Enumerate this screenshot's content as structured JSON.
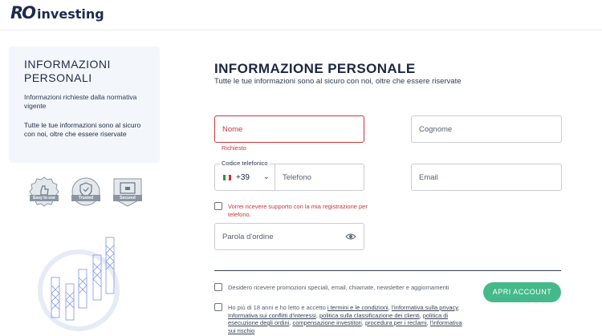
{
  "header": {
    "logo_mark": "RO",
    "logo_text": "investing"
  },
  "info_panel": {
    "title": "INFORMAZIONI PERSONALI",
    "subtitle": "Informazioni richieste dalla normativa vigente",
    "note": "Tutte le tue informazioni sono al sicuro con noi, oltre che essere riservate"
  },
  "badges": [
    {
      "label": "Easy to use",
      "icon": "thumbs-up-icon"
    },
    {
      "label": "Trusted",
      "icon": "shield-check-icon"
    },
    {
      "label": "Secured",
      "icon": "lock-screen-icon"
    }
  ],
  "form": {
    "title": "INFORMAZIONE PERSONALE",
    "subtitle": "Tutte le tue informazioni sono al sicuro con noi, oltre che essere riservate",
    "first_name_placeholder": "Nome",
    "first_name_error": "Richiesto",
    "last_name_placeholder": "Cognome",
    "phone_label": "Codice telefonico",
    "phone_prefix": "+39",
    "phone_placeholder": "Telefono",
    "email_placeholder": "Email",
    "support_checkbox": "Vorrei ricevere supporto con la mia registrazione per telefono.",
    "password_placeholder": "Parola d'ordine",
    "promo_checkbox": "Desidero ricevere promozioni speciali, email, chiamate, newsletter e aggiornamenti",
    "submit_label": "APRI ACCOUNT",
    "legal_prefix": "Ho più di 18 anni e ho letto e accetto ",
    "legal_links": [
      "i termini e le condizioni",
      "l'informativa sulla privacy",
      "Informativa sui conflitti d'interessi",
      "politica sulla classificazione dei clienti",
      "politica di esecuzione degli ordini",
      "compensazione investitori",
      "procedura per i reclami",
      "l'informativa sui rischio"
    ]
  },
  "colors": {
    "brand": "#1c2b4f",
    "error": "#c8373c",
    "accent": "#46b98b"
  }
}
